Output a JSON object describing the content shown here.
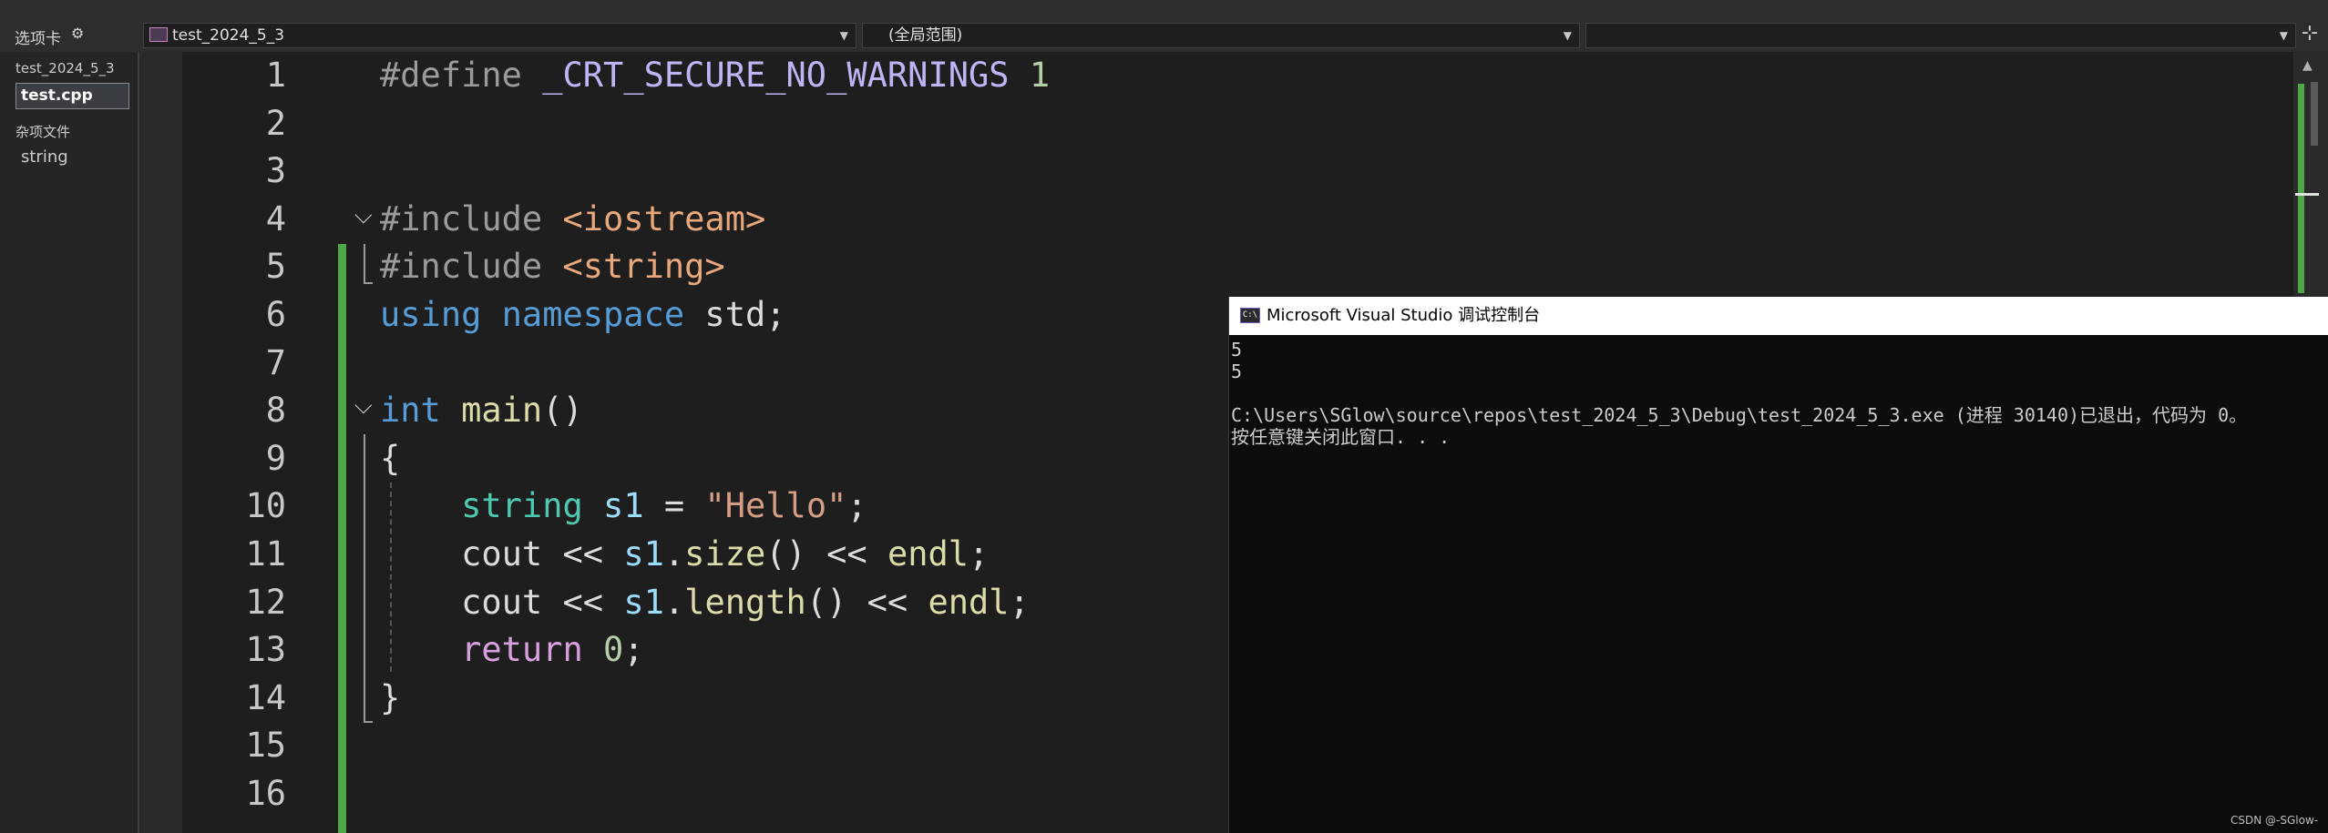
{
  "toolbar": {
    "tabs_label": "选项卡",
    "project_dropdown": "test_2024_5_3",
    "scope_dropdown": "(全局范围)",
    "member_dropdown": ""
  },
  "tab_panel": {
    "project_name": "test_2024_5_3",
    "active_file": "test.cpp",
    "misc_group": "杂项文件",
    "misc_file": "string"
  },
  "editor": {
    "line_numbers": [
      "1",
      "2",
      "3",
      "4",
      "5",
      "6",
      "7",
      "8",
      "9",
      "10",
      "11",
      "12",
      "13",
      "14",
      "15",
      "16"
    ],
    "change_bar_color": "#4fa847",
    "lines": [
      [
        {
          "t": "#define ",
          "c": "pp"
        },
        {
          "t": "_CRT_SECURE_NO_WARNINGS",
          "c": "macro"
        },
        {
          "t": " 1",
          "c": "num"
        }
      ],
      [],
      [],
      [
        {
          "t": "#include ",
          "c": "pp"
        },
        {
          "t": "<iostream>",
          "c": "inc"
        }
      ],
      [
        {
          "t": "#include ",
          "c": "pp"
        },
        {
          "t": "<string>",
          "c": "inc"
        }
      ],
      [
        {
          "t": "using ",
          "c": "kw"
        },
        {
          "t": "namespace ",
          "c": "kw"
        },
        {
          "t": "std;",
          "c": "plain"
        }
      ],
      [],
      [
        {
          "t": "int ",
          "c": "kw"
        },
        {
          "t": "main",
          "c": "fn"
        },
        {
          "t": "()",
          "c": "plain"
        }
      ],
      [
        {
          "t": "{",
          "c": "plain"
        }
      ],
      [
        {
          "t": "    ",
          "c": "plain"
        },
        {
          "t": "string ",
          "c": "type"
        },
        {
          "t": "s1",
          "c": "var"
        },
        {
          "t": " = ",
          "c": "plain"
        },
        {
          "t": "\"Hello\"",
          "c": "str"
        },
        {
          "t": ";",
          "c": "plain"
        }
      ],
      [
        {
          "t": "    ",
          "c": "plain"
        },
        {
          "t": "cout",
          "c": "plain"
        },
        {
          "t": " << ",
          "c": "plain"
        },
        {
          "t": "s1",
          "c": "var"
        },
        {
          "t": ".",
          "c": "plain"
        },
        {
          "t": "size",
          "c": "fn"
        },
        {
          "t": "() << ",
          "c": "plain"
        },
        {
          "t": "endl",
          "c": "fn"
        },
        {
          "t": ";",
          "c": "plain"
        }
      ],
      [
        {
          "t": "    ",
          "c": "plain"
        },
        {
          "t": "cout",
          "c": "plain"
        },
        {
          "t": " << ",
          "c": "plain"
        },
        {
          "t": "s1",
          "c": "var"
        },
        {
          "t": ".",
          "c": "plain"
        },
        {
          "t": "length",
          "c": "fn"
        },
        {
          "t": "() << ",
          "c": "plain"
        },
        {
          "t": "endl",
          "c": "fn"
        },
        {
          "t": ";",
          "c": "plain"
        }
      ],
      [
        {
          "t": "    ",
          "c": "plain"
        },
        {
          "t": "return ",
          "c": "kw2"
        },
        {
          "t": "0",
          "c": "num"
        },
        {
          "t": ";",
          "c": "plain"
        }
      ],
      [
        {
          "t": "}",
          "c": "plain"
        }
      ],
      [],
      []
    ]
  },
  "console": {
    "title": "Microsoft Visual Studio 调试控制台",
    "icon_text": "C:\\",
    "output": "5\n5\n\nC:\\Users\\SGlow\\source\\repos\\test_2024_5_3\\Debug\\test_2024_5_3.exe (进程 30140)已退出，代码为 0。\n按任意键关闭此窗口. . ."
  },
  "watermark": "CSDN @-SGlow-"
}
